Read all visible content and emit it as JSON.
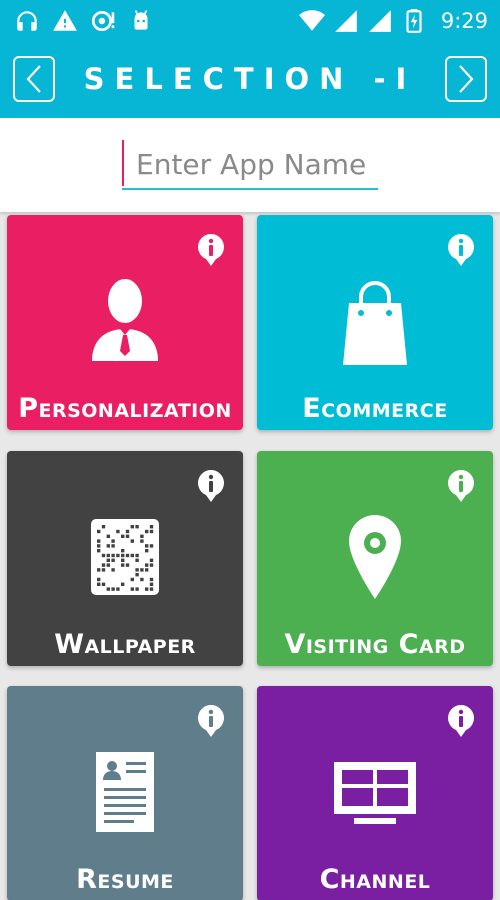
{
  "status_bar": {
    "time": "9:29",
    "icons": [
      "headphones-icon",
      "warning-icon",
      "sync-icon",
      "android-icon",
      "wifi-icon",
      "signal-icon",
      "signal-icon",
      "battery-charging-icon"
    ]
  },
  "app_bar": {
    "title": "SELECTION -I",
    "prev_icon": "chevron-left-icon",
    "next_icon": "chevron-right-icon"
  },
  "search": {
    "placeholder": "Enter App Name",
    "value": ""
  },
  "tiles": [
    {
      "label": "Personalization",
      "color": "#e91e63",
      "icon": "person-icon"
    },
    {
      "label": "Ecommerce",
      "color": "#00bcd4",
      "icon": "shopping-bag-icon"
    },
    {
      "label": "Wallpaper",
      "color": "#424242",
      "icon": "qr-code-icon"
    },
    {
      "label": "Visiting Card",
      "color": "#4caf50",
      "icon": "location-pin-icon"
    },
    {
      "label": "Resume",
      "color": "#607d8b",
      "icon": "resume-icon"
    },
    {
      "label": "Channel",
      "color": "#7b1fa2",
      "icon": "tv-icon"
    }
  ],
  "colors": {
    "accent": "#06b6d4",
    "caret": "#e91e63"
  }
}
